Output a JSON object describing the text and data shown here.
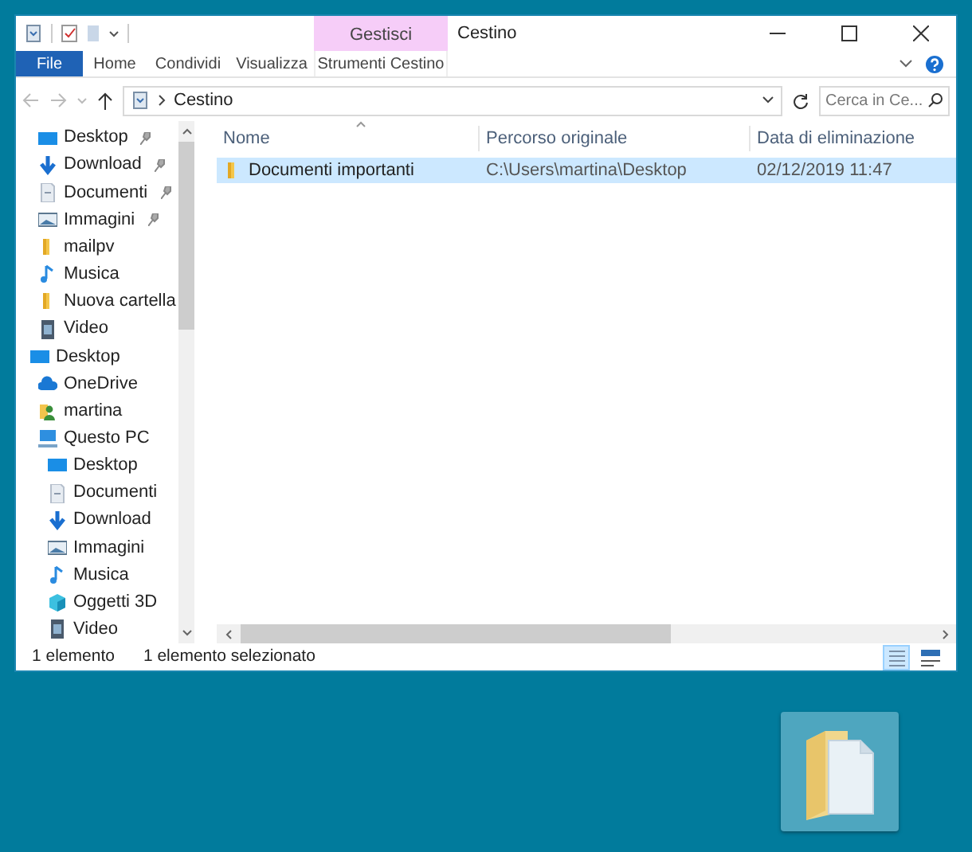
{
  "window": {
    "title": "Cestino"
  },
  "ribbon": {
    "context_group": "Gestisci",
    "tabs": [
      {
        "label": "File",
        "kind": "file",
        "selected": false
      },
      {
        "label": "Home",
        "kind": "tab",
        "selected": false
      },
      {
        "label": "Condividi",
        "kind": "tab",
        "selected": false
      },
      {
        "label": "Visualizza",
        "kind": "tab",
        "selected": false
      },
      {
        "label": "Strumenti Cestino",
        "kind": "context",
        "selected": false
      }
    ]
  },
  "address": {
    "breadcrumb": [
      "Cestino"
    ]
  },
  "search": {
    "placeholder": "Cerca in Ce..."
  },
  "navigation": {
    "quick_access": [
      {
        "label": "Desktop",
        "kind": "desktop",
        "pinned": true,
        "selected": false
      },
      {
        "label": "Download",
        "kind": "download",
        "pinned": true,
        "selected": false
      },
      {
        "label": "Documenti",
        "kind": "documents",
        "pinned": true,
        "selected": false
      },
      {
        "label": "Immagini",
        "kind": "pictures",
        "pinned": true,
        "selected": false
      },
      {
        "label": "mailpv",
        "kind": "folder",
        "pinned": false,
        "selected": false
      },
      {
        "label": "Musica",
        "kind": "music",
        "pinned": false,
        "selected": false
      },
      {
        "label": "Nuova cartella",
        "kind": "folder",
        "pinned": false,
        "selected": false
      },
      {
        "label": "Video",
        "kind": "video",
        "pinned": false,
        "selected": false
      }
    ],
    "tree": [
      {
        "label": "Desktop",
        "kind": "desktop",
        "selected": false,
        "children": [
          {
            "label": "OneDrive",
            "kind": "cloud",
            "selected": false
          },
          {
            "label": "martina",
            "kind": "user",
            "selected": false
          },
          {
            "label": "Questo PC",
            "kind": "pc",
            "selected": false,
            "children": [
              {
                "label": "Desktop",
                "kind": "desktop",
                "selected": false
              },
              {
                "label": "Documenti",
                "kind": "documents",
                "selected": false
              },
              {
                "label": "Download",
                "kind": "download",
                "selected": false
              },
              {
                "label": "Immagini",
                "kind": "pictures",
                "selected": false
              },
              {
                "label": "Musica",
                "kind": "music",
                "selected": false
              },
              {
                "label": "Oggetti 3D",
                "kind": "objects",
                "selected": false
              },
              {
                "label": "Video",
                "kind": "video",
                "selected": false
              }
            ]
          }
        ]
      }
    ]
  },
  "table": {
    "columns": [
      "Nome",
      "Percorso originale",
      "Data di eliminazione"
    ],
    "rows": [
      {
        "name": "Documenti importanti",
        "path": "C:\\Users\\martina\\Desktop",
        "date": "02/12/2019 11:47",
        "selected": true
      }
    ]
  },
  "status_bar": {
    "count": "1 elemento",
    "selection": "1 elemento selezionato",
    "views": [
      {
        "kind": "details",
        "selected": true
      },
      {
        "kind": "large",
        "selected": false
      }
    ]
  },
  "desktop": {
    "icons": [
      {
        "selected": true
      }
    ]
  }
}
